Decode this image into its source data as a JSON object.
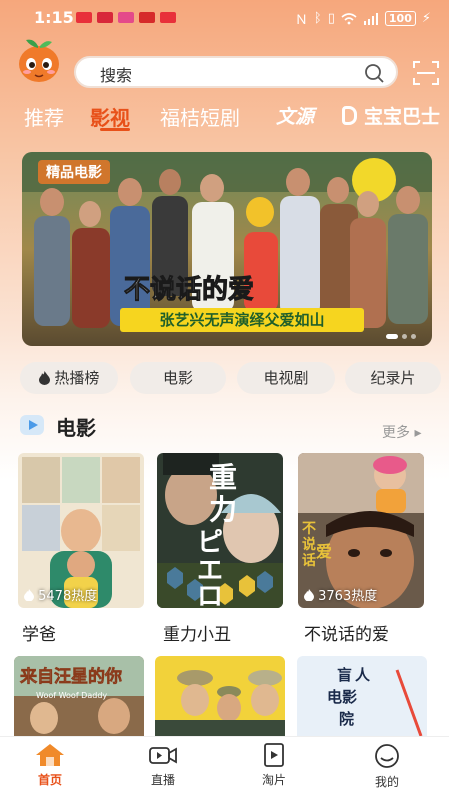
{
  "status_bar": {
    "time": "1:15",
    "battery": "100",
    "notification_colors": [
      "#e8303a",
      "#d8283a",
      "#e44a8a",
      "#d62a2a",
      "#e8303a"
    ]
  },
  "search": {
    "placeholder": "搜索"
  },
  "tabs": [
    {
      "label": "推荐",
      "active": false
    },
    {
      "label": "影视",
      "active": true
    },
    {
      "label": "福桔短剧",
      "active": false
    },
    {
      "label": "文源",
      "active": false
    },
    {
      "label": "宝宝巴士",
      "active": false
    }
  ],
  "banner": {
    "tag": "精品电影",
    "title": "不说话的爱",
    "subtitle": "张艺兴无声演绎父爱如山",
    "active_slide": 1,
    "slide_count": 3
  },
  "categories": [
    "热播榜",
    "电影",
    "电视剧",
    "纪录片"
  ],
  "section": {
    "title": "电影",
    "more": "更多"
  },
  "movies": [
    {
      "title": "学爸",
      "heat": "5478热度"
    },
    {
      "title": "重力小丑",
      "heat": ""
    },
    {
      "title": "不说话的爱",
      "heat": "3763热度"
    }
  ],
  "movies_row2": [
    {
      "overlay": "来自汪星的你"
    },
    {
      "overlay": ""
    },
    {
      "overlay": "盲人电影院"
    }
  ],
  "posters_text": {
    "gravity": "重力ピエロ",
    "silent_love": "不说话的爱",
    "woof_daddy": "Woof Woof Daddy"
  },
  "bottom_nav": [
    {
      "label": "首页",
      "icon": "home-icon",
      "active": true
    },
    {
      "label": "直播",
      "icon": "video-icon",
      "active": false
    },
    {
      "label": "淘片",
      "icon": "film-icon",
      "active": false
    },
    {
      "label": "我的",
      "icon": "profile-icon",
      "active": false
    }
  ],
  "colors": {
    "accent": "#e8511a",
    "chip_bg": "#f1ece8"
  }
}
